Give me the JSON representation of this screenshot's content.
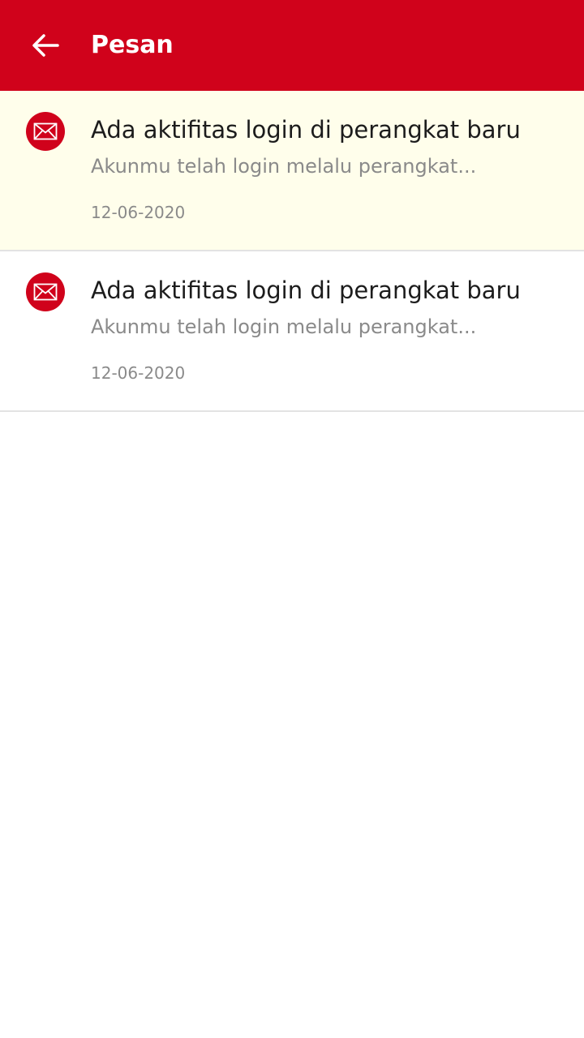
{
  "header": {
    "title": "Pesan",
    "back_icon": "arrow-left-icon",
    "background_color": "#d0021b"
  },
  "messages": [
    {
      "icon": "mail-icon",
      "title": "Ada aktifitas login di perangkat baru",
      "preview": "Akunmu telah login melalu perangkat...",
      "date": "12-06-2020",
      "unread": true
    },
    {
      "icon": "mail-icon",
      "title": "Ada aktifitas login di perangkat baru",
      "preview": "Akunmu telah login melalu perangkat...",
      "date": "12-06-2020",
      "unread": false
    }
  ]
}
